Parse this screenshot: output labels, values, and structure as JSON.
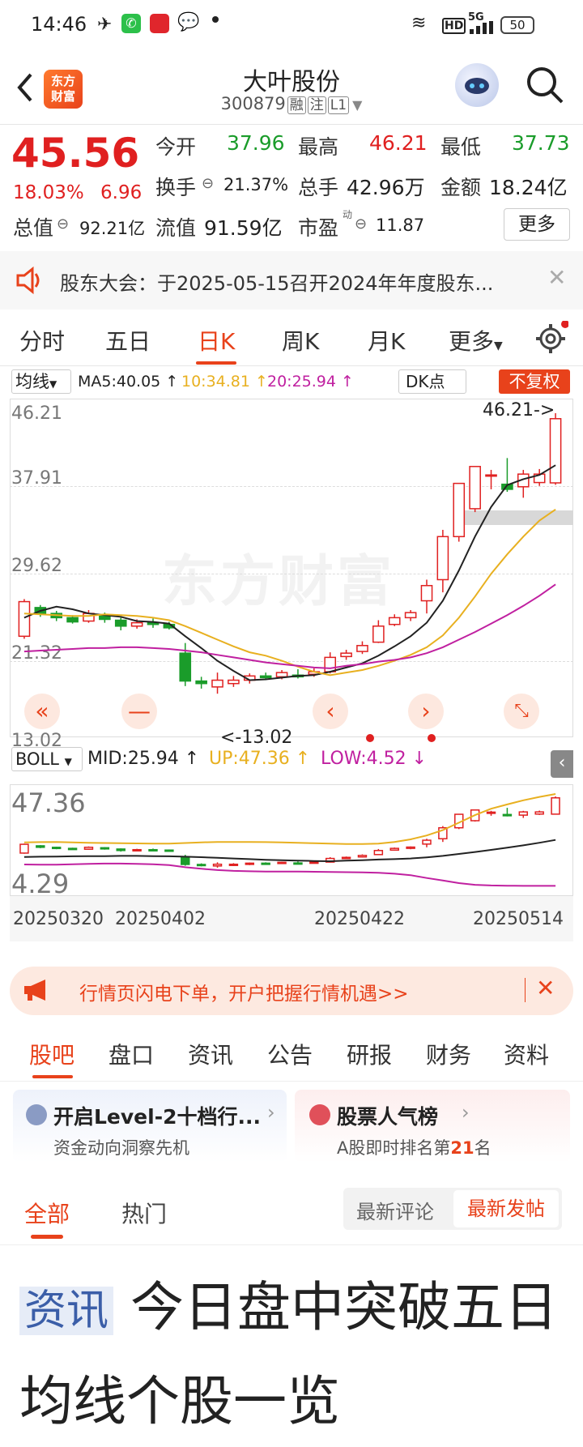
{
  "status_bar": {
    "time": "14:46",
    "battery": "50",
    "network": "5G",
    "hd": "HD"
  },
  "header": {
    "logo_text_1": "东方",
    "logo_text_2": "财富",
    "title": "大叶股份",
    "code": "300879",
    "tags": [
      "融",
      "注",
      "L1"
    ]
  },
  "quote": {
    "price": "45.56",
    "change_pct": "18.03%",
    "change": "6.96",
    "open_label": "今开",
    "open": "37.96",
    "high_label": "最高",
    "high": "46.21",
    "low_label": "最低",
    "low": "37.73",
    "turnover_label": "换手",
    "turnover": "21.37%",
    "volume_label": "总手",
    "volume": "42.96万",
    "amount_label": "金额",
    "amount": "18.24亿",
    "total_cap_label": "总值",
    "total_cap": "92.21亿",
    "float_cap_label": "流值",
    "float_cap": "91.59亿",
    "pe_label": "市盈",
    "pe_sup": "动",
    "pe": "11.87",
    "more_button": "更多"
  },
  "notice": {
    "text": "股东大会：于2025-05-15召开2024年年度股东..."
  },
  "tabs": [
    "分时",
    "五日",
    "日K",
    "周K",
    "月K",
    "更多"
  ],
  "active_tab": "日K",
  "chart_controls": {
    "ma_selector": "均线",
    "ma5": "MA5:40.05",
    "ma10": "10:34.81",
    "ma20": "20:25.94",
    "dk_button": "DK点",
    "adjust_button": "不复权",
    "max_marker": "46.21->",
    "min_marker": "<-13.02",
    "boll_selector": "BOLL",
    "boll_mid": "MID:25.94",
    "boll_up": "UP:47.36",
    "boll_low": "LOW:4.52",
    "watermark": "东方财富"
  },
  "colors": {
    "up": "#e02020",
    "down": "#1a9c2a",
    "ma5": "#222222",
    "ma10": "#e8b020",
    "ma20": "#c020a0",
    "accent": "#e8421b"
  },
  "chart_data": [
    {
      "type": "candlestick",
      "title": "日K",
      "y_ticks": [
        "46.21",
        "37.91",
        "29.62",
        "21.32",
        "13.02"
      ],
      "ylim": [
        13.02,
        46.21
      ],
      "ohlc": [
        [
          19.8,
          24.2,
          19.5,
          23.9
        ],
        [
          23.2,
          23.5,
          22.1,
          22.5
        ],
        [
          22.5,
          22.8,
          21.6,
          22.0
        ],
        [
          22.0,
          22.3,
          21.3,
          21.5
        ],
        [
          21.6,
          22.9,
          21.4,
          22.5
        ],
        [
          22.3,
          22.6,
          21.4,
          21.8
        ],
        [
          21.7,
          22.0,
          20.5,
          21.0
        ],
        [
          21.0,
          21.8,
          20.7,
          21.4
        ],
        [
          21.4,
          21.9,
          20.8,
          21.2
        ],
        [
          21.2,
          21.5,
          20.6,
          20.8
        ],
        [
          17.8,
          19.0,
          13.9,
          14.5
        ],
        [
          14.5,
          15.0,
          13.6,
          14.2
        ],
        [
          13.8,
          15.5,
          13.0,
          14.6
        ],
        [
          14.2,
          15.1,
          13.8,
          14.6
        ],
        [
          14.6,
          15.4,
          14.2,
          15.1
        ],
        [
          15.1,
          15.5,
          14.6,
          14.9
        ],
        [
          15.0,
          15.8,
          14.7,
          15.5
        ],
        [
          15.2,
          15.9,
          14.8,
          15.0
        ],
        [
          15.3,
          16.0,
          15.0,
          15.6
        ],
        [
          15.6,
          17.9,
          15.4,
          17.3
        ],
        [
          17.4,
          18.2,
          17.0,
          17.8
        ],
        [
          18.0,
          19.2,
          17.7,
          18.7
        ],
        [
          19.1,
          21.7,
          19.0,
          21.0
        ],
        [
          21.2,
          22.4,
          21.0,
          22.0
        ],
        [
          22.0,
          22.9,
          21.6,
          22.6
        ],
        [
          24.0,
          26.5,
          22.5,
          25.8
        ],
        [
          26.5,
          32.4,
          25.0,
          31.6
        ],
        [
          31.6,
          37.9,
          31.0,
          37.9
        ],
        [
          34.9,
          39.9,
          34.5,
          39.9
        ],
        [
          38.9,
          39.5,
          37.2,
          38.9
        ],
        [
          37.8,
          40.9,
          36.9,
          37.2
        ],
        [
          37.5,
          39.5,
          36.2,
          39.0
        ],
        [
          38.0,
          39.6,
          37.6,
          39.0
        ],
        [
          37.96,
          46.21,
          37.73,
          45.56
        ]
      ],
      "ma5": [
        22.0,
        22.8,
        23.3,
        23.0,
        22.5,
        22.3,
        22.1,
        21.6,
        21.5,
        21.3,
        19.8,
        18.4,
        16.9,
        15.7,
        14.6,
        14.7,
        14.9,
        15.1,
        15.2,
        15.6,
        16.1,
        16.6,
        17.5,
        18.6,
        19.8,
        21.4,
        24.0,
        27.6,
        31.6,
        35.1,
        37.7,
        38.4,
        38.9,
        40.05
      ],
      "ma10": [
        22.5,
        22.4,
        22.3,
        22.2,
        22.2,
        22.4,
        22.3,
        22.2,
        22.0,
        21.7,
        21.0,
        20.2,
        19.4,
        18.6,
        17.9,
        17.5,
        16.9,
        16.2,
        15.6,
        15.2,
        15.5,
        15.8,
        16.3,
        16.9,
        17.6,
        18.5,
        19.9,
        22.0,
        24.5,
        27.2,
        29.5,
        31.6,
        33.5,
        34.81
      ],
      "ma20": [
        18.0,
        18.1,
        18.2,
        18.3,
        18.4,
        18.4,
        18.5,
        18.5,
        18.4,
        18.3,
        18.1,
        17.9,
        17.6,
        17.3,
        17.0,
        16.7,
        16.5,
        16.3,
        16.1,
        16.0,
        16.3,
        16.5,
        16.8,
        17.0,
        17.3,
        17.8,
        18.5,
        19.4,
        20.3,
        21.3,
        22.3,
        23.4,
        24.6,
        25.94
      ]
    },
    {
      "type": "line",
      "title": "BOLL",
      "y_ticks": [
        "47.36",
        "4.29"
      ],
      "ylim": [
        4.29,
        47.36
      ],
      "x_labels": [
        "20250320",
        "20250402",
        "20250422",
        "20250514"
      ],
      "up": [
        24.8,
        24.9,
        25.0,
        24.8,
        24.6,
        24.5,
        24.4,
        24.3,
        24.2,
        24.2,
        24.5,
        24.8,
        25.0,
        25.0,
        25.0,
        24.9,
        24.8,
        24.6,
        24.4,
        24.2,
        24.0,
        24.0,
        24.2,
        25.0,
        26.2,
        28.0,
        30.5,
        34.0,
        37.5,
        40.5,
        42.5,
        44.4,
        46.0,
        47.36
      ],
      "mid": [
        18.0,
        18.1,
        18.2,
        18.3,
        18.4,
        18.4,
        18.5,
        18.5,
        18.4,
        18.3,
        18.1,
        17.9,
        17.6,
        17.3,
        17.0,
        16.7,
        16.5,
        16.3,
        16.1,
        16.0,
        16.3,
        16.5,
        16.8,
        17.0,
        17.3,
        17.8,
        18.5,
        19.4,
        20.3,
        21.3,
        22.3,
        23.4,
        24.6,
        25.94
      ],
      "low": [
        14.5,
        14.4,
        14.4,
        14.6,
        14.8,
        14.9,
        14.9,
        14.8,
        14.6,
        14.2,
        13.2,
        12.5,
        11.9,
        11.5,
        11.3,
        11.2,
        11.2,
        11.2,
        11.1,
        11.0,
        10.9,
        10.8,
        10.6,
        10.2,
        9.5,
        8.2,
        7.0,
        5.8,
        5.0,
        4.7,
        4.6,
        4.5,
        4.5,
        4.52
      ]
    }
  ],
  "ad": {
    "text": "行情页闪电下单，开户把握行情机遇>>"
  },
  "bottom_tabs": [
    "股吧",
    "盘口",
    "资讯",
    "公告",
    "研报",
    "财务",
    "资料"
  ],
  "cards": [
    {
      "title": "开启Level-2十档行...",
      "subtitle": "资金动向洞察先机"
    },
    {
      "title": "股票人气榜",
      "subtitle_prefix": "A股即时排名第",
      "rank": "21",
      "subtitle_suffix": "名"
    }
  ],
  "feed_tabs": {
    "all": "全部",
    "hot": "热门",
    "latest_comment": "最新评论",
    "latest_post": "最新发帖"
  },
  "article": {
    "tag": "资讯",
    "headline": "今日盘中突破五日均线个股一览"
  }
}
